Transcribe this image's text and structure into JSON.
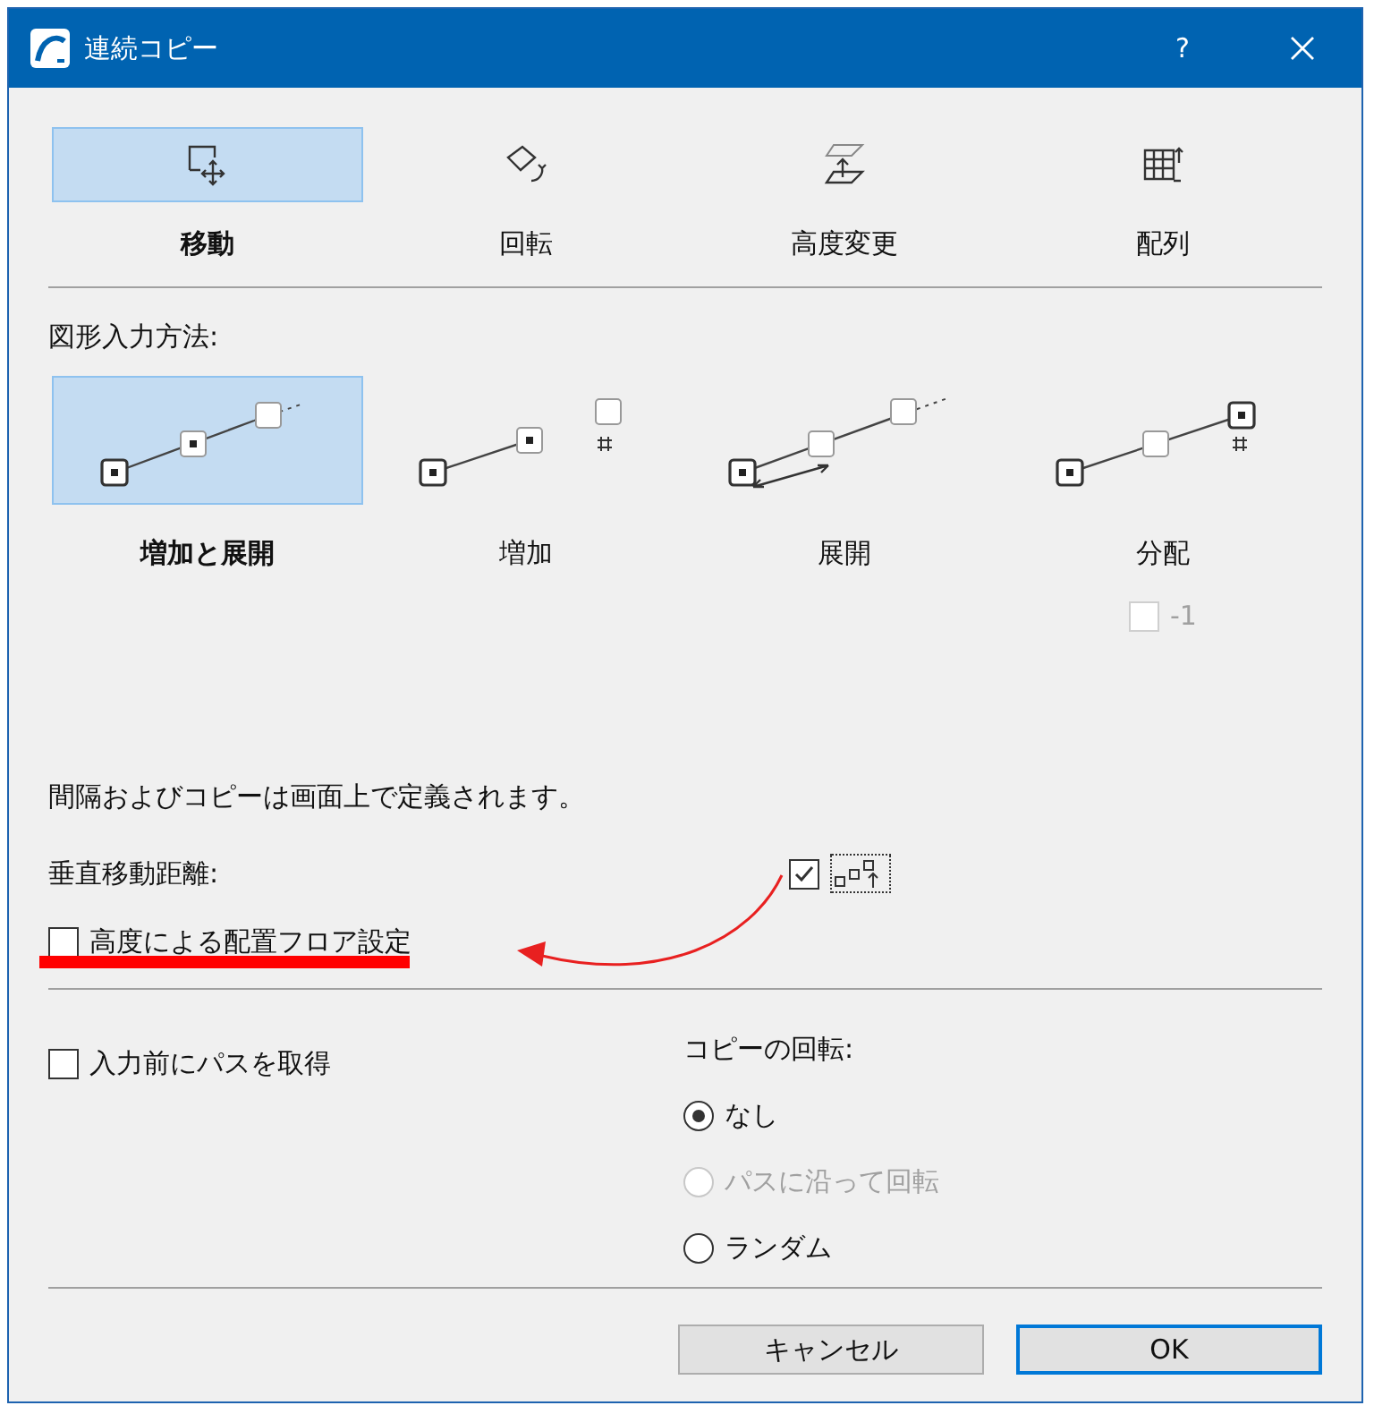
{
  "window": {
    "title": "連続コピー",
    "help": "?"
  },
  "modes": [
    {
      "kind": "move",
      "label": "移動",
      "selected": true
    },
    {
      "kind": "rotate",
      "label": "回転",
      "selected": false
    },
    {
      "kind": "elevate",
      "label": "高度変更",
      "selected": false
    },
    {
      "kind": "array",
      "label": "配列",
      "selected": false
    }
  ],
  "input_method": {
    "label": "図形入力方法:",
    "options": [
      {
        "kind": "increment_spread",
        "label": "増加と展開",
        "selected": true
      },
      {
        "kind": "increment",
        "label": "増加",
        "selected": false
      },
      {
        "kind": "spread",
        "label": "展開",
        "selected": false
      },
      {
        "kind": "distribute",
        "label": "分配",
        "selected": false
      }
    ],
    "minus_one": {
      "label": "-1",
      "checked": false,
      "disabled": true
    }
  },
  "info_text": "間隔およびコピーは画面上で定義されます。",
  "vertical": {
    "label": "垂直移動距離:",
    "checked": true
  },
  "floor_by_elevation": {
    "label": "高度による配置フロア設定",
    "checked": false
  },
  "pick_path": {
    "label": "入力前にパスを取得",
    "checked": false
  },
  "rotation": {
    "label": "コピーの回転:",
    "options": [
      {
        "label": "なし",
        "selected": true,
        "disabled": false
      },
      {
        "label": "パスに沿って回転",
        "selected": false,
        "disabled": true
      },
      {
        "label": "ランダム",
        "selected": false,
        "disabled": false
      }
    ]
  },
  "buttons": [
    {
      "label": "キャンセル",
      "default": false
    },
    {
      "label": "OK",
      "default": true
    }
  ]
}
